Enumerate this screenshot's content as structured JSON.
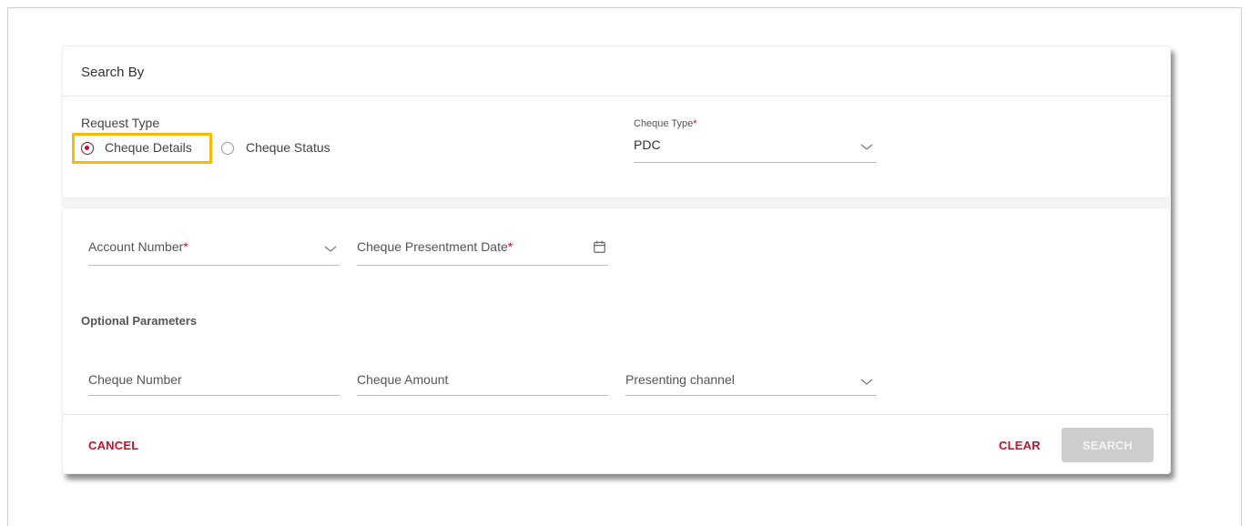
{
  "search_by": {
    "title": "Search By",
    "request_type_label": "Request Type",
    "options": [
      {
        "label": "Cheque Details",
        "selected": true
      },
      {
        "label": "Cheque Status",
        "selected": false
      }
    ],
    "cheque_type": {
      "label": "Cheque Type",
      "required_mark": "*",
      "value": "PDC"
    }
  },
  "criteria": {
    "account_number": {
      "label": "Account Number",
      "required_mark": "*"
    },
    "presentment_date": {
      "label": "Cheque Presentment Date",
      "required_mark": "*"
    },
    "optional_title": "Optional Parameters",
    "cheque_number": {
      "label": "Cheque Number"
    },
    "cheque_amount": {
      "label": "Cheque Amount"
    },
    "presenting_channel": {
      "label": "Presenting channel"
    }
  },
  "actions": {
    "cancel": "CANCEL",
    "clear": "CLEAR",
    "search": "SEARCH"
  },
  "colors": {
    "accent": "#c8102e",
    "highlight": "#f5bb08",
    "disabled_button": "#cdcdcd"
  }
}
